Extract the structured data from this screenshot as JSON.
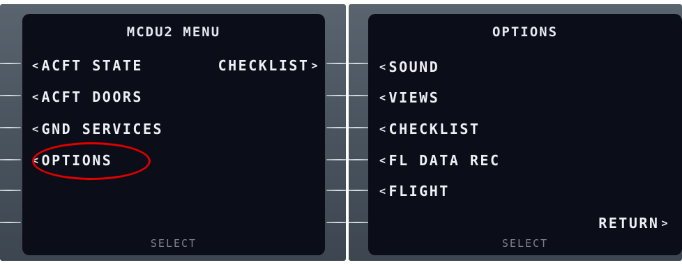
{
  "left_screen": {
    "title": "MCDU2 MENU",
    "items": [
      {
        "label": "ACFT STATE"
      },
      {
        "label": "ACFT DOORS"
      },
      {
        "label": "GND SERVICES"
      },
      {
        "label": "OPTIONS",
        "highlighted": true
      }
    ],
    "right_items": [
      {
        "label": "CHECKLIST"
      }
    ],
    "footer": "SELECT",
    "caret_left": "<",
    "caret_right": ">"
  },
  "right_screen": {
    "title": "OPTIONS",
    "items": [
      {
        "label": "SOUND"
      },
      {
        "label": "VIEWS"
      },
      {
        "label": "CHECKLIST"
      },
      {
        "label": "FL DATA REC"
      },
      {
        "label": "FLIGHT"
      }
    ],
    "right_items": [
      {
        "label": "RETURN"
      }
    ],
    "footer": "SELECT",
    "caret_left": "<",
    "caret_right": ">"
  },
  "colors": {
    "screen_bg": "#0b0d18",
    "text": "#eef0f4",
    "footer_text": "#7c8290",
    "highlight": "#e00000"
  }
}
